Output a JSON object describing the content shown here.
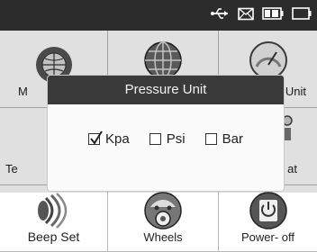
{
  "status_icons": [
    "usb-icon",
    "message-icon",
    "battery-icon",
    "battery-empty-icon"
  ],
  "grid": {
    "row1": [
      {
        "label": "M",
        "icon": "globe-icon"
      },
      {
        "label": "",
        "icon": "grid-globe-icon"
      },
      {
        "label": "Unit",
        "icon": "gauge-icon"
      }
    ],
    "row2": [
      {
        "label": "Te",
        "icon": ""
      },
      {
        "label": "",
        "icon": ""
      },
      {
        "label": "at",
        "icon": "tool-icon"
      }
    ],
    "row3": [
      {
        "label": "Beep Set",
        "icon": "speaker-icon"
      },
      {
        "label": "Wheels",
        "icon": "car-wheel-icon"
      },
      {
        "label": "Power- off",
        "icon": "power-icon"
      }
    ]
  },
  "dialog": {
    "title": "Pressure Unit",
    "options": [
      {
        "label": "Kpa",
        "checked": true
      },
      {
        "label": "Psi",
        "checked": false
      },
      {
        "label": "Bar",
        "checked": false
      }
    ]
  }
}
